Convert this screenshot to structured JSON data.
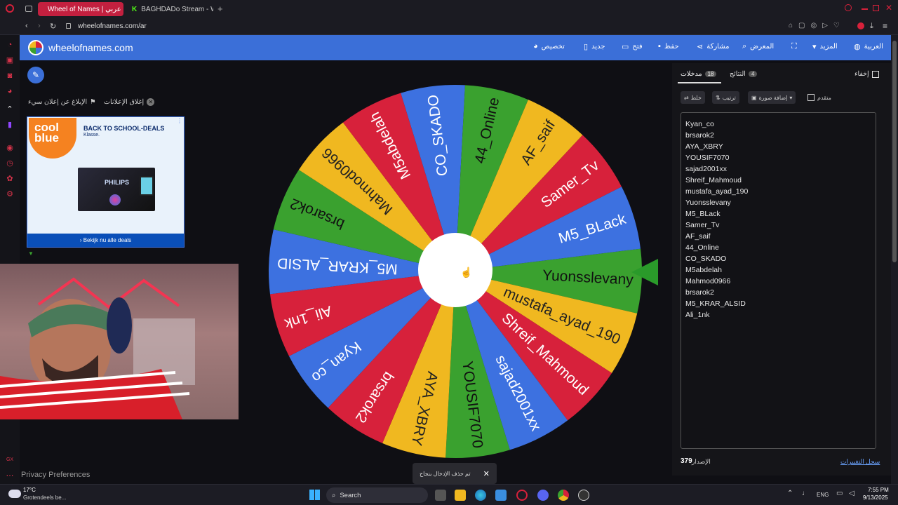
{
  "browser": {
    "tabs": [
      {
        "label": "Wheel of Names | عربي",
        "active": true
      },
      {
        "label": "BAGHDADo Stream - Wat",
        "active": false
      }
    ],
    "url": "wheelofnames.com/ar"
  },
  "site": {
    "logo_text": "wheelofnames.com",
    "nav": {
      "customize": "تخصيص",
      "new": "جديد",
      "open": "فتح",
      "save": "حفظ",
      "share": "مشاركة",
      "gallery": "المعرض",
      "more": "المزيد",
      "language": "العربية"
    }
  },
  "ads": {
    "report": "الإبلاغ عن إعلان سيء",
    "close": "إغلاق الإعلانات",
    "banner_title": "BACK TO SCHOOL-DEALS",
    "banner_sub": "Klasse.",
    "brand": "cool blue",
    "philips": "PHILIPS",
    "cta": "› Bekijk nu alle deals"
  },
  "wheel": {
    "slices": [
      {
        "label": "Yuonsslevany",
        "color": "#3aa12f"
      },
      {
        "label": "mustafa_ayad_190",
        "color": "#f0b820"
      },
      {
        "label": "Shreif_Mahmoud",
        "color": "#d7213b"
      },
      {
        "label": "sajad2001xx",
        "color": "#3d71e0"
      },
      {
        "label": "YOUSIF7070",
        "color": "#3aa12f"
      },
      {
        "label": "AYA_XBRY",
        "color": "#f0b820"
      },
      {
        "label": "brsarok2",
        "color": "#d7213b"
      },
      {
        "label": "Kyan_co",
        "color": "#3d71e0"
      },
      {
        "label": "Ali_1nk",
        "color": "#d7213b"
      },
      {
        "label": "M5_KRAR_ALSID",
        "color": "#3d71e0"
      },
      {
        "label": "brsarok2",
        "color": "#3aa12f"
      },
      {
        "label": "Mahmod0966",
        "color": "#f0b820"
      },
      {
        "label": "M5abdelah",
        "color": "#d7213b"
      },
      {
        "label": "CO_SKADO",
        "color": "#3d71e0"
      },
      {
        "label": "44_Online",
        "color": "#3aa12f"
      },
      {
        "label": "AF_saif",
        "color": "#f0b820"
      },
      {
        "label": "Samer_Tv",
        "color": "#d7213b"
      },
      {
        "label": "M5_BLack",
        "color": "#3d71e0"
      }
    ]
  },
  "panel": {
    "hide": "إخفاء",
    "entries_tab": "مدخلات",
    "entries_count": "18",
    "results_tab": "النتائج",
    "results_count": "4",
    "shuffle": "خلط",
    "sort": "ترتيب",
    "add_image": "إضافة صورة",
    "advanced": "متقدم",
    "entries": [
      "Kyan_co",
      "brsarok2",
      "AYA_XBRY",
      "YOUSIF7070",
      "sajad2001xx",
      "Shreif_Mahmoud",
      "mustafa_ayad_190",
      "Yuonsslevany",
      "M5_BLack",
      "Samer_Tv",
      "AF_saif",
      "44_Online",
      "CO_SKADO",
      "M5abdelah",
      "Mahmod0966",
      "brsarok2",
      "M5_KRAR_ALSID",
      "Ali_1nk"
    ],
    "version_label": "الإصدار",
    "version": "379",
    "changelog": "سجل التغييرات"
  },
  "toast": "تم حذف الإدخال بنجاح",
  "privacy": "Privacy Preferences",
  "taskbar": {
    "weather_temp": "17°C",
    "weather_desc": "Grotendeels be...",
    "search": "Search",
    "lang": "ENG",
    "time": "7:55 PM",
    "date": "9/13/2025"
  }
}
